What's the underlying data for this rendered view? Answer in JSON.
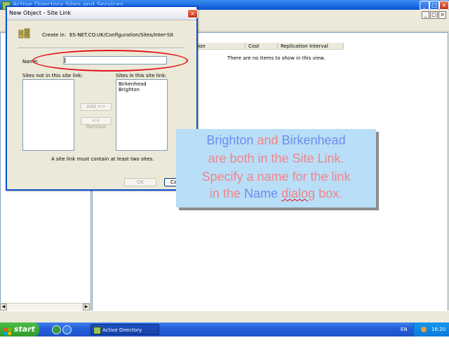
{
  "main_window": {
    "title": "Active Directory Sites and Services",
    "list_columns": [
      "ation",
      "Cost",
      "Replication Interval"
    ],
    "empty_message": "There are no items to show in this view."
  },
  "dialog": {
    "title": "New Object - Site Link",
    "create_in_label": "Create in:",
    "create_in_path": "ES-NET.CO.UK/Configuration/Sites/Inter-Sit",
    "name_label": "Name:",
    "name_value": "",
    "sites_not_in_label": "Sites not in this site link:",
    "sites_in_label": "Sites in this site link:",
    "sites_in": [
      "Birkenhead",
      "Brighton"
    ],
    "add_button": "Add >>",
    "remove_button": "<< Remove",
    "note": "A site link must contain at least two sites.",
    "ok_button": "OK",
    "cancel_button": "Can"
  },
  "overlay": {
    "line1_a": "Brighton",
    "line1_b": "and",
    "line1_c": "Birkenhead",
    "line2": "are both in the Site Link.",
    "line3": "Specify a name for the link",
    "line4_a": "in the",
    "line4_b": "Name",
    "line4_c": "dialog",
    "line4_d": "box."
  },
  "taskbar": {
    "start_label": "start",
    "task_label": "Active Directory Sites...",
    "language": "EN",
    "clock": "16:20"
  },
  "colors": {
    "annotation_red": "#e2141b",
    "overlay_bg": "#b9def7",
    "overlay_text_pink": "#f0868a",
    "overlay_text_blue": "#6a8ef0"
  },
  "icons": [
    "site-link-icon",
    "close-icon",
    "minimize-icon",
    "maximize-icon",
    "windows-logo-icon",
    "ie-icon",
    "scroll-left-icon",
    "scroll-right-icon"
  ]
}
